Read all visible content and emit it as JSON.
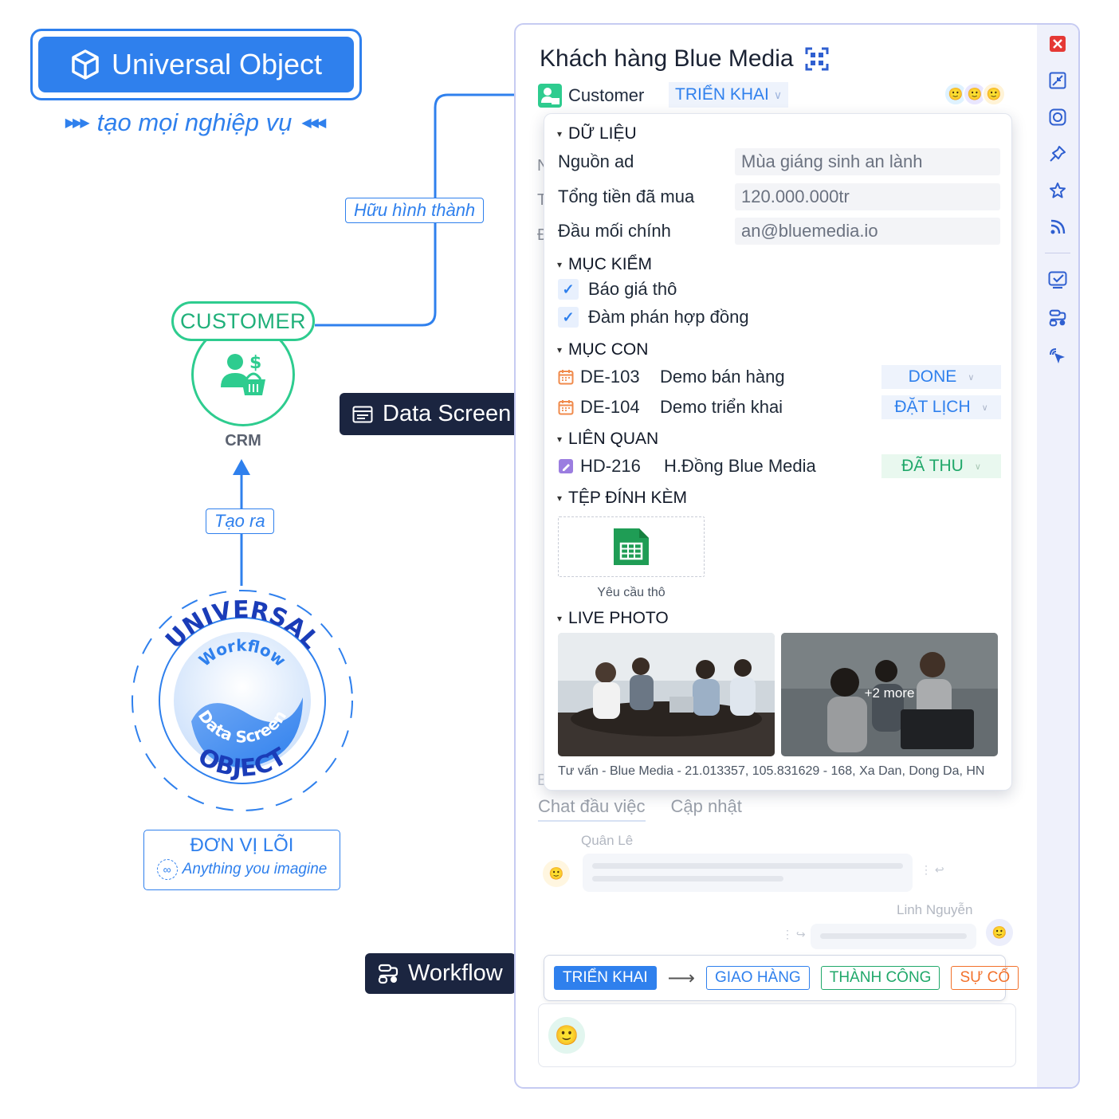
{
  "hero": {
    "title": "Universal Object",
    "tagline": "tạo mọi nghiệp vụ",
    "icon": "cube-icon"
  },
  "flow": {
    "huu_hinh_thanh": "Hữu hình thành",
    "customer": "CUSTOMER",
    "crm": "CRM",
    "tao_ra": "Tạo ra"
  },
  "emblem": {
    "top": "UNIVERSAL",
    "bottom": "OBJECT",
    "inner_top": "Workflow",
    "inner_bottom": "Data Screen"
  },
  "core": {
    "title": "ĐƠN VỊ LÕI",
    "subtitle": "Anything you imagine",
    "icon": "infinity-icon"
  },
  "callouts": {
    "data_screen": "Data Screen",
    "workflow": "Workflow"
  },
  "panel": {
    "title": "Khách hàng Blue Media",
    "type_label": "Customer",
    "status": "TRIỂN KHAI",
    "ghost_letters": [
      "N",
      "T",
      "Đ",
      "B"
    ],
    "tabs": [
      "Chat đầu việc",
      "Cập nhật"
    ],
    "chat": [
      {
        "name": "Quân Lê"
      },
      {
        "name": "Linh Nguyễn"
      }
    ],
    "workflow_steps": [
      {
        "label": "TRIỂN KHAI",
        "color": "#2f80ed"
      },
      {
        "label": "GIAO HÀNG",
        "color": "#2f80ed"
      },
      {
        "label": "THÀNH CÔNG",
        "color": "#20a86a"
      },
      {
        "label": "SỰ CỐ",
        "color": "#f2712b"
      }
    ],
    "sidebar_icons": [
      "close-icon",
      "collapse-icon",
      "help-icon",
      "pin-icon",
      "star-icon",
      "rss-icon",
      "task-icon",
      "workflow-icon",
      "cursor-icon"
    ]
  },
  "card": {
    "sections": {
      "data": "DỮ LIỆU",
      "checks": "MỤC KIỂM",
      "children": "MỤC CON",
      "related": "LIÊN QUAN",
      "attachments": "TỆP ĐÍNH KÈM",
      "live_photo": "LIVE PHOTO"
    },
    "fields": [
      {
        "label": "Nguồn ad",
        "value": "Mùa giáng sinh an lành"
      },
      {
        "label": "Tổng tiền đã mua",
        "value": "120.000.000tr"
      },
      {
        "label": "Đầu mối chính",
        "value": "an@bluemedia.io"
      }
    ],
    "checklist": [
      {
        "label": "Báo giá thô",
        "checked": true
      },
      {
        "label": "Đàm phán hợp đồng",
        "checked": true
      }
    ],
    "children": [
      {
        "code": "DE-103",
        "name": "Demo bán hàng",
        "status": "DONE",
        "status_color": "#2f80ed",
        "status_bg": "#eef3fc"
      },
      {
        "code": "DE-104",
        "name": "Demo triển khai",
        "status": "ĐẶT LỊCH",
        "status_color": "#2f80ed",
        "status_bg": "#eef3fc"
      }
    ],
    "related": [
      {
        "code": "HD-216",
        "name": "H.Đồng Blue Media",
        "status": "ĐÃ THU",
        "status_color": "#20a86a",
        "status_bg": "#e9f8ef"
      }
    ],
    "attachment": {
      "name": "Yêu cầu thô",
      "icon": "spreadsheet-icon"
    },
    "photos_more": "+2 more",
    "address": "Tư vấn - Blue Media - 21.013357, 105.831629 - 168, Xa Dan, Dong Da, HN"
  }
}
